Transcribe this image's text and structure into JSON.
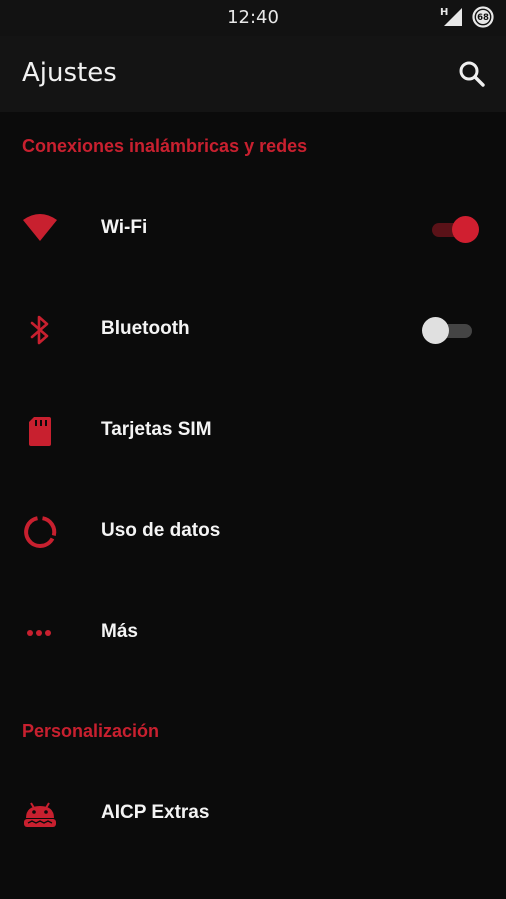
{
  "status_bar": {
    "time": "12:40",
    "network_type": "H",
    "battery_level": "68"
  },
  "app_bar": {
    "title": "Ajustes",
    "search_icon": "search-icon"
  },
  "colors": {
    "accent": "#c8202f",
    "background": "#0b0b0b",
    "text": "#f4f4f4"
  },
  "sections": [
    {
      "header": "Conexiones inalámbricas y redes",
      "items": [
        {
          "label": "Wi-Fi",
          "icon": "wifi-icon",
          "toggle": "on"
        },
        {
          "label": "Bluetooth",
          "icon": "bluetooth-icon",
          "toggle": "off"
        },
        {
          "label": "Tarjetas SIM",
          "icon": "sim-card-icon"
        },
        {
          "label": "Uso de datos",
          "icon": "data-usage-icon"
        },
        {
          "label": "Más",
          "icon": "more-icon"
        }
      ]
    },
    {
      "header": "Personalización",
      "items": [
        {
          "label": "AICP Extras",
          "icon": "android-icon"
        }
      ]
    }
  ]
}
